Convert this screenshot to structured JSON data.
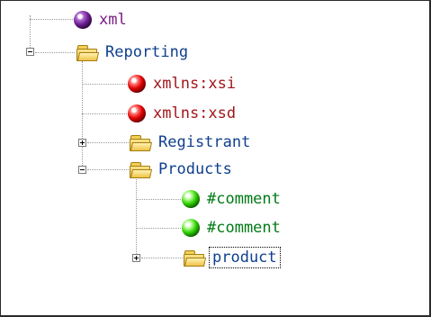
{
  "tree": {
    "nodes": [
      {
        "label": "xml",
        "type": "processing-instruction",
        "icon": "purple-ball-icon",
        "expanded": null
      },
      {
        "label": "Reporting",
        "type": "element",
        "icon": "folder-icon",
        "expanded": true
      },
      {
        "label": "xmlns:xsi",
        "type": "attribute",
        "icon": "red-ball-icon",
        "expanded": null
      },
      {
        "label": "xmlns:xsd",
        "type": "attribute",
        "icon": "red-ball-icon",
        "expanded": null
      },
      {
        "label": "Registrant",
        "type": "element",
        "icon": "folder-icon",
        "expanded": false
      },
      {
        "label": "Products",
        "type": "element",
        "icon": "folder-icon",
        "expanded": true
      },
      {
        "label": "#comment",
        "type": "comment",
        "icon": "green-ball-icon",
        "expanded": null
      },
      {
        "label": "#comment",
        "type": "comment",
        "icon": "green-ball-icon",
        "expanded": null
      },
      {
        "label": "product",
        "type": "element",
        "icon": "folder-icon",
        "expanded": false,
        "selected": true
      }
    ]
  },
  "colors": {
    "processing_instruction": "#7b1d86",
    "attribute": "#a2161b",
    "element": "#0f3f8f",
    "comment": "#007a16",
    "connector": "#9a9a9a"
  }
}
